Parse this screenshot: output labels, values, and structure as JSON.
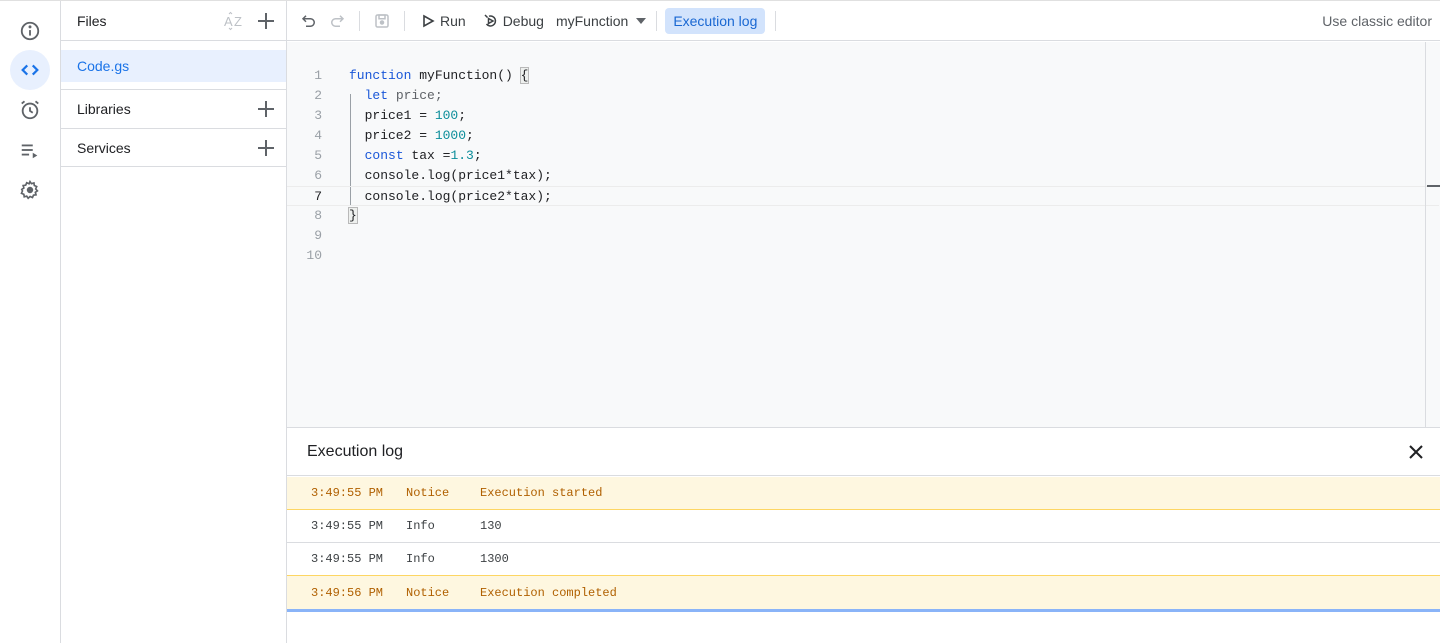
{
  "rail": {
    "items": [
      {
        "icon": "info-icon",
        "label": "Overview"
      },
      {
        "icon": "code-icon",
        "label": "Editor",
        "active": true
      },
      {
        "icon": "alarm-clock-icon",
        "label": "Triggers"
      },
      {
        "icon": "executions-icon",
        "label": "Executions"
      },
      {
        "icon": "gear-icon",
        "label": "Project Settings"
      }
    ]
  },
  "files": {
    "title": "Files",
    "sort_icon": "sort-az-icon",
    "items": [
      {
        "name": "Code.gs",
        "selected": true
      }
    ],
    "sections": [
      {
        "label": "Libraries"
      },
      {
        "label": "Services"
      }
    ]
  },
  "toolbar": {
    "undo_icon": "undo-icon",
    "redo_icon": "redo-icon",
    "save_icon": "save-icon",
    "run_label": "Run",
    "debug_label": "Debug",
    "function_select": "myFunction",
    "execution_log_label": "Execution log",
    "classic_editor_label": "Use classic editor"
  },
  "editor": {
    "current_line": 7,
    "lines": [
      {
        "n": "1",
        "tokens": [
          {
            "t": "kw",
            "v": "function"
          },
          {
            "t": "",
            "v": " myFunction() "
          },
          {
            "t": "brace",
            "v": "{"
          }
        ]
      },
      {
        "n": "2",
        "tokens": [
          {
            "t": "",
            "v": "  "
          },
          {
            "t": "kw",
            "v": "let"
          },
          {
            "t": "dim",
            "v": " price;"
          }
        ]
      },
      {
        "n": "3",
        "tokens": [
          {
            "t": "",
            "v": "  price1 = "
          },
          {
            "t": "num",
            "v": "100"
          },
          {
            "t": "",
            "v": ";"
          }
        ]
      },
      {
        "n": "4",
        "tokens": [
          {
            "t": "",
            "v": "  price2 = "
          },
          {
            "t": "num",
            "v": "1000"
          },
          {
            "t": "",
            "v": ";"
          }
        ]
      },
      {
        "n": "5",
        "tokens": [
          {
            "t": "",
            "v": "  "
          },
          {
            "t": "kw",
            "v": "const"
          },
          {
            "t": "",
            "v": " tax ="
          },
          {
            "t": "num",
            "v": "1.3"
          },
          {
            "t": "",
            "v": ";"
          }
        ]
      },
      {
        "n": "6",
        "tokens": [
          {
            "t": "",
            "v": "  console.log(price1*tax);"
          }
        ]
      },
      {
        "n": "7",
        "tokens": [
          {
            "t": "",
            "v": "  console.log(price2*tax);"
          }
        ]
      },
      {
        "n": "8",
        "tokens": [
          {
            "t": "brace",
            "v": "}"
          }
        ]
      },
      {
        "n": "9",
        "tokens": []
      },
      {
        "n": "10",
        "tokens": []
      }
    ]
  },
  "execution_log": {
    "title": "Execution log",
    "rows": [
      {
        "time": "3:49:55 PM",
        "level": "Notice",
        "message": "Execution started"
      },
      {
        "time": "3:49:55 PM",
        "level": "Info",
        "message": "130"
      },
      {
        "time": "3:49:55 PM",
        "level": "Info",
        "message": "1300"
      },
      {
        "time": "3:49:56 PM",
        "level": "Notice",
        "message": "Execution completed"
      }
    ]
  },
  "colors": {
    "accent": "#1a73e8",
    "notice_bg": "#fef7e0",
    "notice_text": "#b06000",
    "keyword": "#1a57d8",
    "number": "#0b8d9a"
  }
}
